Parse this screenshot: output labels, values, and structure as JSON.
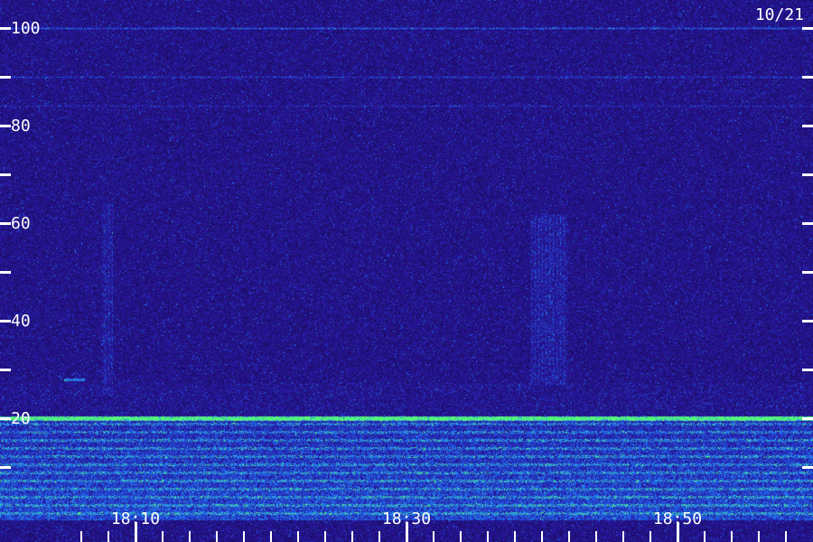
{
  "date_label": "10/21",
  "colors": {
    "background": "#1c1068",
    "noise_low": "#2a1a90",
    "noise_mid": "#3a2ad8",
    "band_mid": "#2f5cff",
    "band_high": "#40f0a0",
    "tick": "#ffffff"
  },
  "chart_data": {
    "type": "heatmap",
    "title": "",
    "xlabel": "",
    "ylabel": "",
    "ylim": [
      0,
      105
    ],
    "xlim": [
      "18:04",
      "18:59"
    ],
    "grid": false,
    "legend": "none",
    "y_labeled_ticks": [
      20,
      40,
      60,
      80,
      100
    ],
    "y_minor_ticks": [
      10,
      30,
      50,
      70,
      90
    ],
    "y_tick_labels": [
      "20",
      "40",
      "60",
      "80",
      "100"
    ],
    "x_labeled_ticks": [
      "18:10",
      "18:30",
      "18:50"
    ],
    "x_minor_ticks": [
      "18:06",
      "18:08",
      "18:12",
      "18:14",
      "18:16",
      "18:18",
      "18:20",
      "18:22",
      "18:24",
      "18:26",
      "18:28",
      "18:32",
      "18:34",
      "18:36",
      "18:38",
      "18:40",
      "18:42",
      "18:44",
      "18:46",
      "18:48",
      "18:52",
      "18:54",
      "18:56",
      "18:58"
    ],
    "x_tick_labels": [
      "18:10",
      "18:30",
      "18:50"
    ],
    "horizontal_lines": [
      {
        "y": 100,
        "intensity": 0.8
      },
      {
        "y": 90,
        "intensity": 0.5
      },
      {
        "y": 84,
        "intensity": 0.35
      },
      {
        "y": 20,
        "intensity": 1.0
      }
    ],
    "vertical_bursts": [
      {
        "x_start": "18:07.5",
        "x_end": "18:08.3",
        "y_min": 25,
        "y_max": 64,
        "intensity": 0.55
      },
      {
        "x_start": "18:39.2",
        "x_end": "18:41.8",
        "y_min": 27,
        "y_max": 62,
        "intensity": 0.6
      }
    ],
    "short_segments": [
      {
        "x_start": "18:04.7",
        "x_end": "18:06.2",
        "y": 28,
        "intensity": 0.7
      }
    ],
    "low_band": {
      "y_min": 0,
      "y_max": 20,
      "intensity": 0.9
    }
  }
}
